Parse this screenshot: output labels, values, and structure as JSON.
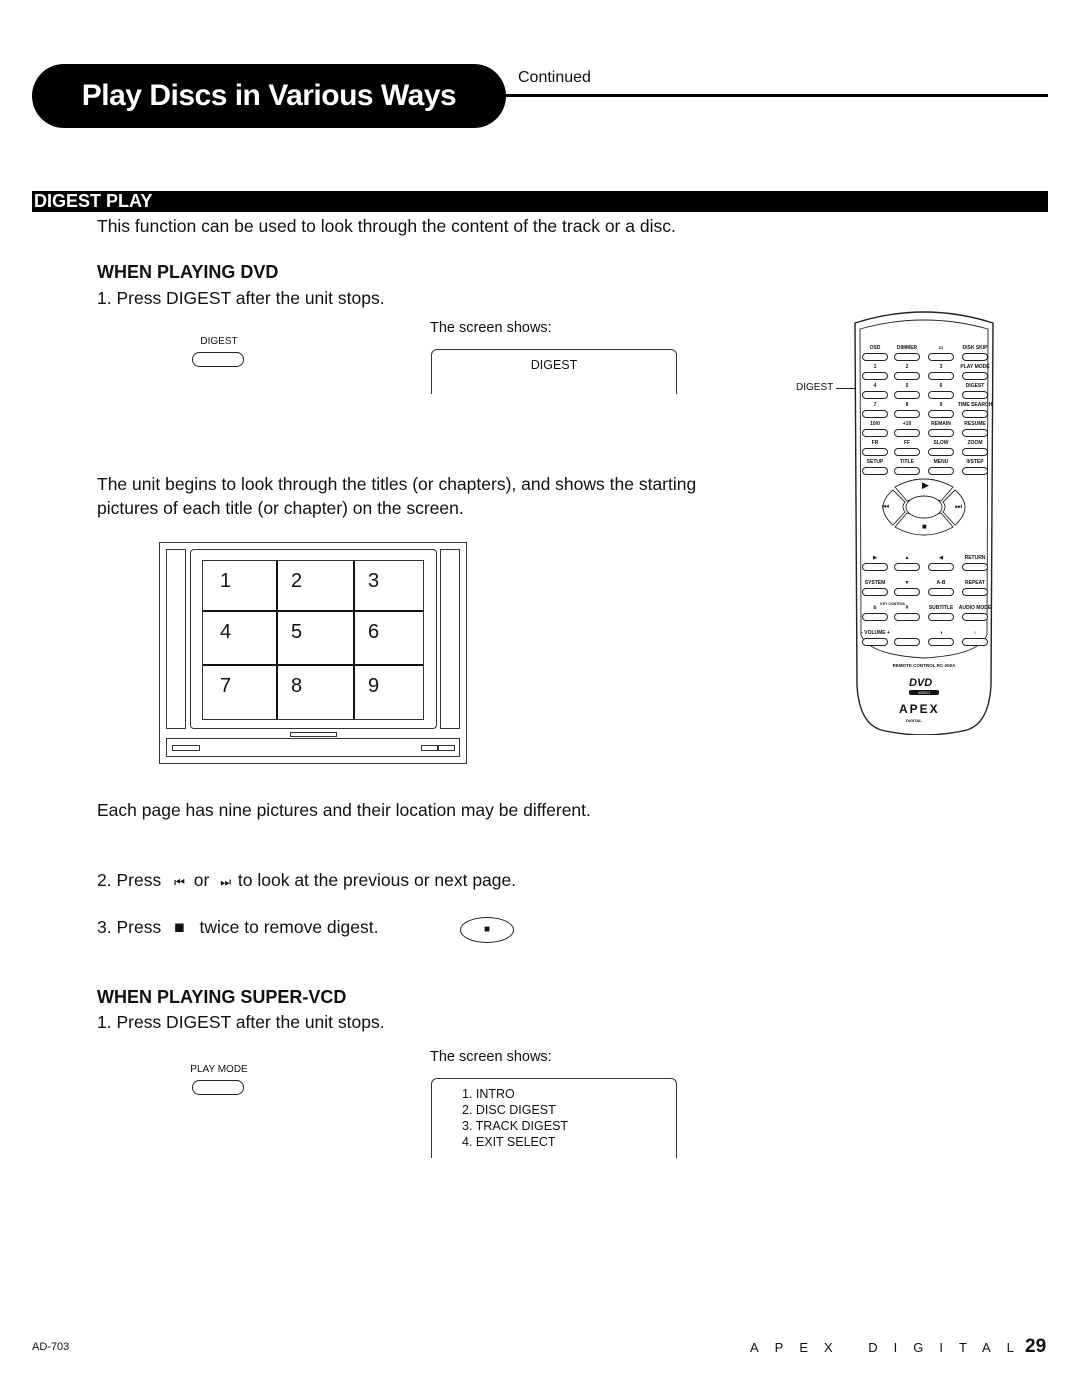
{
  "header": {
    "title": "Play Discs in Various Ways",
    "continued": "Continued"
  },
  "section": {
    "title": "DIGEST PLAY",
    "intro": "This function can be used to look through the content of the track or a disc."
  },
  "dvd": {
    "heading": "WHEN PLAYING DVD",
    "step1": "1. Press DIGEST after the unit stops.",
    "button_label": "DIGEST",
    "screen_caption": "The screen shows:",
    "screen_text": "DIGEST",
    "description_line1": "The unit begins to look through the titles (or chapters), and shows the starting",
    "description_line2": "pictures of each title (or chapter) on the screen.",
    "grid_numbers": [
      "1",
      "2",
      "3",
      "4",
      "5",
      "6",
      "7",
      "8",
      "9"
    ],
    "page_note": "Each page has nine pictures and their location may be different.",
    "step2_prefix": "2. Press",
    "step2_or": "or",
    "step2_suffix": "to look at the previous or next page.",
    "step3_prefix": "3. Press",
    "step3_suffix": "twice to remove digest.",
    "icons": {
      "prev": "⏮",
      "next": "⏭",
      "stop": "■"
    }
  },
  "remote": {
    "callout": "DIGEST",
    "rows": [
      [
        "OSD",
        "DIMMER",
        "▭",
        "DISK SKIP"
      ],
      [
        "1",
        "2",
        "3",
        "PLAY MODE"
      ],
      [
        "4",
        "5",
        "6",
        "DIGEST"
      ],
      [
        "7",
        "8",
        "9",
        "TIME SEARCH"
      ],
      [
        "10/0",
        "+10",
        "REMAIN",
        "RESUME"
      ],
      [
        "FR",
        "FF",
        "SLOW",
        "ZOOM"
      ],
      [
        "SETUP",
        "TITLE",
        "MENU",
        "II/STEP"
      ]
    ],
    "lower_rows": [
      [
        "▶",
        "▲",
        "◀",
        "RETURN"
      ],
      [
        "SYSTEM",
        "▼",
        "A-B",
        "REPEAT"
      ],
      [
        "b",
        "#",
        "SUBTITLE",
        "AUDIO MODE"
      ],
      [
        "–  VOLUME  +",
        "",
        "◑",
        "♁"
      ]
    ],
    "key_control": "KEY CONTROL",
    "model": "REMOTE CONTROL RC-200A",
    "dvd_logo": "DVD",
    "dvd_sub": "VIDEO",
    "brand_logo": "APEX",
    "brand_sub": "DIGITAL"
  },
  "svcd": {
    "heading": "WHEN PLAYING SUPER-VCD",
    "step1": "1. Press DIGEST after the unit stops.",
    "button_label": "PLAY MODE",
    "screen_caption": "The screen shows:",
    "menu": [
      "1. INTRO",
      "2. DISC DIGEST",
      "3. TRACK DIGEST",
      "4. EXIT SELECT"
    ]
  },
  "footer": {
    "model": "AD-703",
    "brand": "APEX DIGITAL",
    "page": "29"
  }
}
